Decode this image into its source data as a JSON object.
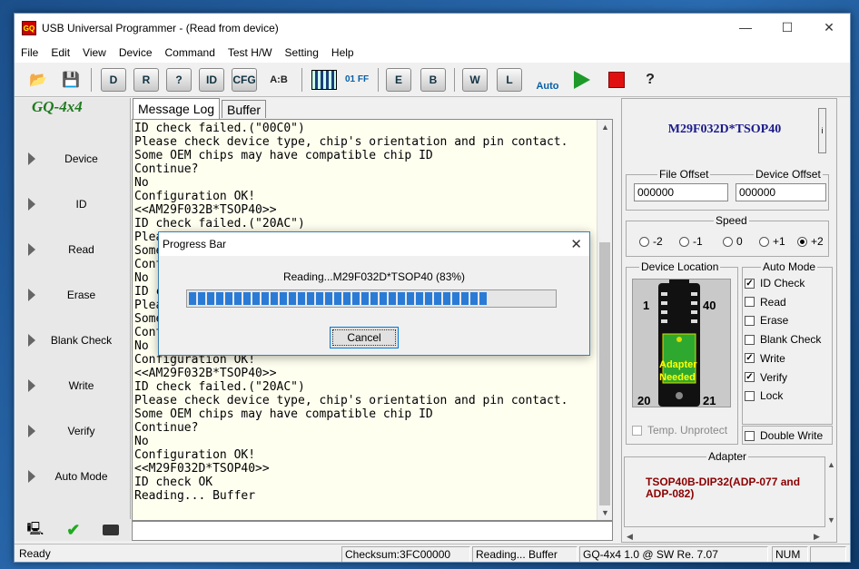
{
  "window": {
    "title": "USB Universal Programmer - (Read from device)",
    "icon_text": "GQ",
    "min": "—",
    "max": "☐",
    "close": "✕"
  },
  "menu": [
    "File",
    "Edit",
    "View",
    "Device",
    "Command",
    "Test H/W",
    "Setting",
    "Help"
  ],
  "toolbar": {
    "items": [
      "open",
      "save",
      "D",
      "R",
      "?",
      "ID",
      "CFG",
      "A:B",
      "calc",
      "01 FF",
      "E",
      "B",
      "W",
      "L",
      "Auto",
      "run",
      "stop",
      "?"
    ]
  },
  "sidebar": {
    "logo": "GQ-4x4",
    "items": [
      "Device",
      "ID",
      "Read",
      "Erase",
      "Blank Check",
      "Write",
      "Verify",
      "Auto Mode"
    ]
  },
  "tabs": [
    "Message Log",
    "Buffer"
  ],
  "log": {
    "lines": [
      "ID check failed.(\"00C0\")",
      "Please check device type, chip's orientation and pin contact.",
      "Some OEM chips may have compatible chip ID",
      "Continue?",
      "No",
      "Configuration OK!",
      "<<AM29F032B*TSOP40>>",
      "ID check failed.(\"20AC\")",
      "Please check device type, chip's orientation and pin contact.",
      "Some OEM chips may have compatible chip ID",
      "Continue?",
      "No",
      "ID check failed.(\"20AC\")",
      "Please check device type, chip's orientation and pin contact.",
      "Some OEM chips may have compatible chip ID",
      "Continue?",
      "No",
      "Configuration OK!",
      "<<AM29F032B*TSOP40>>",
      "ID check failed.(\"20AC\")",
      "Please check device type, chip's orientation and pin contact.",
      "Some OEM chips may have compatible chip ID",
      "Continue?",
      "No",
      "Configuration OK!",
      "<<M29F032D*TSOP40>>",
      "ID check OK",
      "Reading... Buffer"
    ]
  },
  "right": {
    "chip": "M29F032D*TSOP40",
    "chip_btn": "i",
    "file_offset_label": "File Offset",
    "file_offset": "000000",
    "device_offset_label": "Device Offset",
    "device_offset": "000000",
    "speed_label": "Speed",
    "speeds": [
      "-2",
      "-1",
      "0",
      "+1",
      "+2"
    ],
    "speed_selected": 4,
    "device_location_label": "Device Location",
    "pin_tl": "1",
    "pin_tr": "40",
    "pin_bl": "20",
    "pin_br": "21",
    "adapter_needed": "Adapter\nNeeded",
    "temp_unprotect": "Temp. Unprotect",
    "auto_mode_label": "Auto Mode",
    "auto_mode": [
      {
        "label": "ID Check",
        "checked": true
      },
      {
        "label": "Read",
        "checked": false
      },
      {
        "label": "Erase",
        "checked": false
      },
      {
        "label": "Blank Check",
        "checked": false
      },
      {
        "label": "Write",
        "checked": true
      },
      {
        "label": "Verify",
        "checked": true
      },
      {
        "label": "Lock",
        "checked": false
      }
    ],
    "double_write": "Double Write",
    "adapter_label": "Adapter",
    "adapter": "TSOP40B-DIP32(ADP-077 and ADP-082)"
  },
  "status": {
    "ready": "Ready",
    "checksum": "Checksum:3FC00000",
    "reading": "Reading... Buffer",
    "version": "GQ-4x4 1.0 @ SW Re. 7.07",
    "num": "NUM"
  },
  "dialog": {
    "title": "Progress Bar",
    "close": "✕",
    "message": "Reading...M29F032D*TSOP40 (83%)",
    "progress": 0.83,
    "cancel": "Cancel"
  },
  "colors": {
    "accent": "#2a7bd6",
    "log_bg": "#fffff0",
    "chip_text": "#1a1a8c",
    "adapter_text": "#8b0000",
    "logo": "#1f7a1f"
  }
}
